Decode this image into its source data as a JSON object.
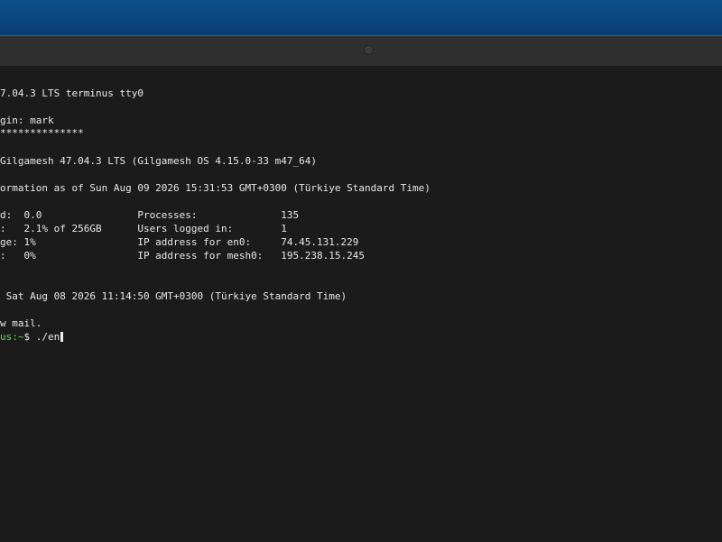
{
  "terminal": {
    "lines": [
      "7.04.3 LTS terminus tty0",
      "gin: mark",
      "**************",
      "Gilgamesh 47.04.3 LTS (Gilgamesh OS 4.15.0-33 m47_64)",
      "ormation as of Sun Aug 09 2026 15:31:53 GMT+0300 (Türkiye Standard Time)",
      "d:  0.0                Processes:              135",
      ":   2.1% of 256GB      Users logged in:        1",
      "ge: 1%                 IP address for en0:     74.45.131.229",
      ":   0%                 IP address for mesh0:   195.238.15.245",
      " Sat Aug 08 2026 11:14:50 GMT+0300 (Türkiye Standard Time)",
      "w mail."
    ],
    "prompt_path": "us:~",
    "prompt_symbol": "$ ",
    "command": "./en"
  }
}
